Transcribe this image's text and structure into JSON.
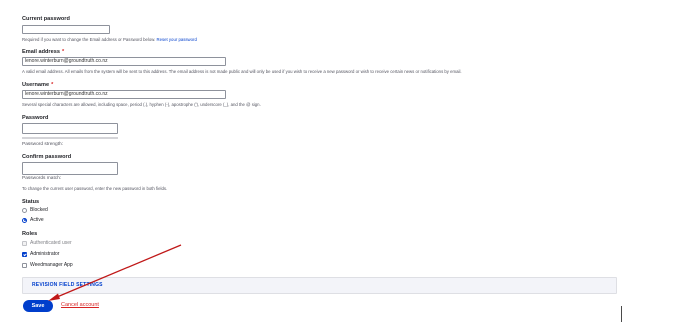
{
  "current_password": {
    "label": "Current password",
    "value": "",
    "description": "Required if you want to change the Email address or Password below.",
    "reset_link": "Reset your password"
  },
  "email": {
    "label": "Email address",
    "required_mark": "*",
    "value": "lenore.winterburn@groundtruth.co.nz",
    "description": "A valid email address. All emails from the system will be sent to this address. The email address is not made public and will only be used if you wish to receive a new password or wish to receive certain news or notifications by email."
  },
  "username": {
    "label": "Username",
    "required_mark": "*",
    "value": "lenore.winterburn@groundtruth.co.nz",
    "description": "Several special characters are allowed, including space, period (.), hyphen (-), apostrophe ('), underscore (_), and the @ sign."
  },
  "password": {
    "label": "Password",
    "value": "",
    "strength_label": "Password strength:"
  },
  "confirm_password": {
    "label": "Confirm password",
    "value": "",
    "match_label": "Passwords match:",
    "description": "To change the current user password, enter the new password in both fields."
  },
  "status": {
    "label": "Status",
    "options": [
      {
        "label": "Blocked",
        "checked": false
      },
      {
        "label": "Active",
        "checked": true
      }
    ]
  },
  "roles": {
    "label": "Roles",
    "options": [
      {
        "label": "Authenticated user",
        "checked": false,
        "disabled": true
      },
      {
        "label": "Administrator",
        "checked": true,
        "disabled": false
      },
      {
        "label": "Weedmanager App",
        "checked": false,
        "disabled": false
      }
    ]
  },
  "revision": {
    "title": "REVISION FIELD SETTINGS"
  },
  "actions": {
    "save_label": "Save",
    "cancel_label": "Cancel account"
  },
  "colors": {
    "accent": "#003ecc",
    "danger": "#d72222",
    "annotation_arrow": "#c01818"
  }
}
